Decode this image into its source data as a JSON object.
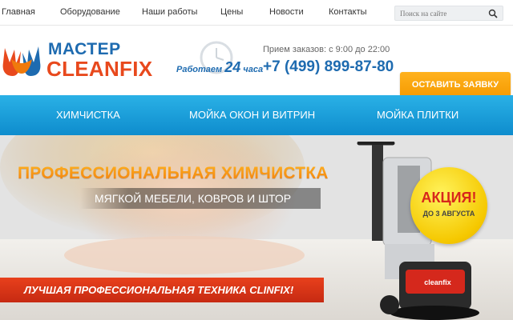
{
  "topnav": {
    "items": [
      "Главная",
      "Оборудование",
      "Наши работы",
      "Цены",
      "Новости",
      "Контакты"
    ],
    "search_placeholder": "Поиск на сайте"
  },
  "header": {
    "logo_line1": "МАСТЕР",
    "logo_line2": "CLEANFIX",
    "hours_prefix": "Работаем",
    "hours_number": "24",
    "hours_suffix": "часа",
    "schedule": "Прием заказов: с 9:00 до 22:00",
    "phone": "+7 (499) 899-87-80",
    "cta_label": "ОСТАВИТЬ ЗАЯВКУ"
  },
  "servnav": {
    "items": [
      "ХИМЧИСТКА",
      "МОЙКА ОКОН И ВИТРИН",
      "МОЙКА ПЛИТКИ"
    ]
  },
  "banner": {
    "headline": "ПРОФЕССИОНАЛЬНАЯ ХИМЧИСТКА",
    "subline": "МЯГКОЙ МЕБЕЛИ, КОВРОВ И ШТОР",
    "ribbon": "ЛУЧШАЯ ПРОФЕССИОНАЛЬНАЯ ТЕХНИКА CLINFIX!",
    "promo_title": "АКЦИЯ!",
    "promo_date": "ДО 3 АВГУСТА",
    "machine_brand": "cleanfix"
  },
  "colors": {
    "brand_blue": "#1e6bb0",
    "brand_orange": "#e8491d",
    "cta_orange": "#f59a00",
    "nav_blue": "#1a9fdc",
    "ribbon_red": "#d8341a",
    "promo_yellow": "#f5c800"
  },
  "icons": {
    "logo": "hands-logo-icon",
    "clock": "clock-icon",
    "search": "search-icon"
  }
}
